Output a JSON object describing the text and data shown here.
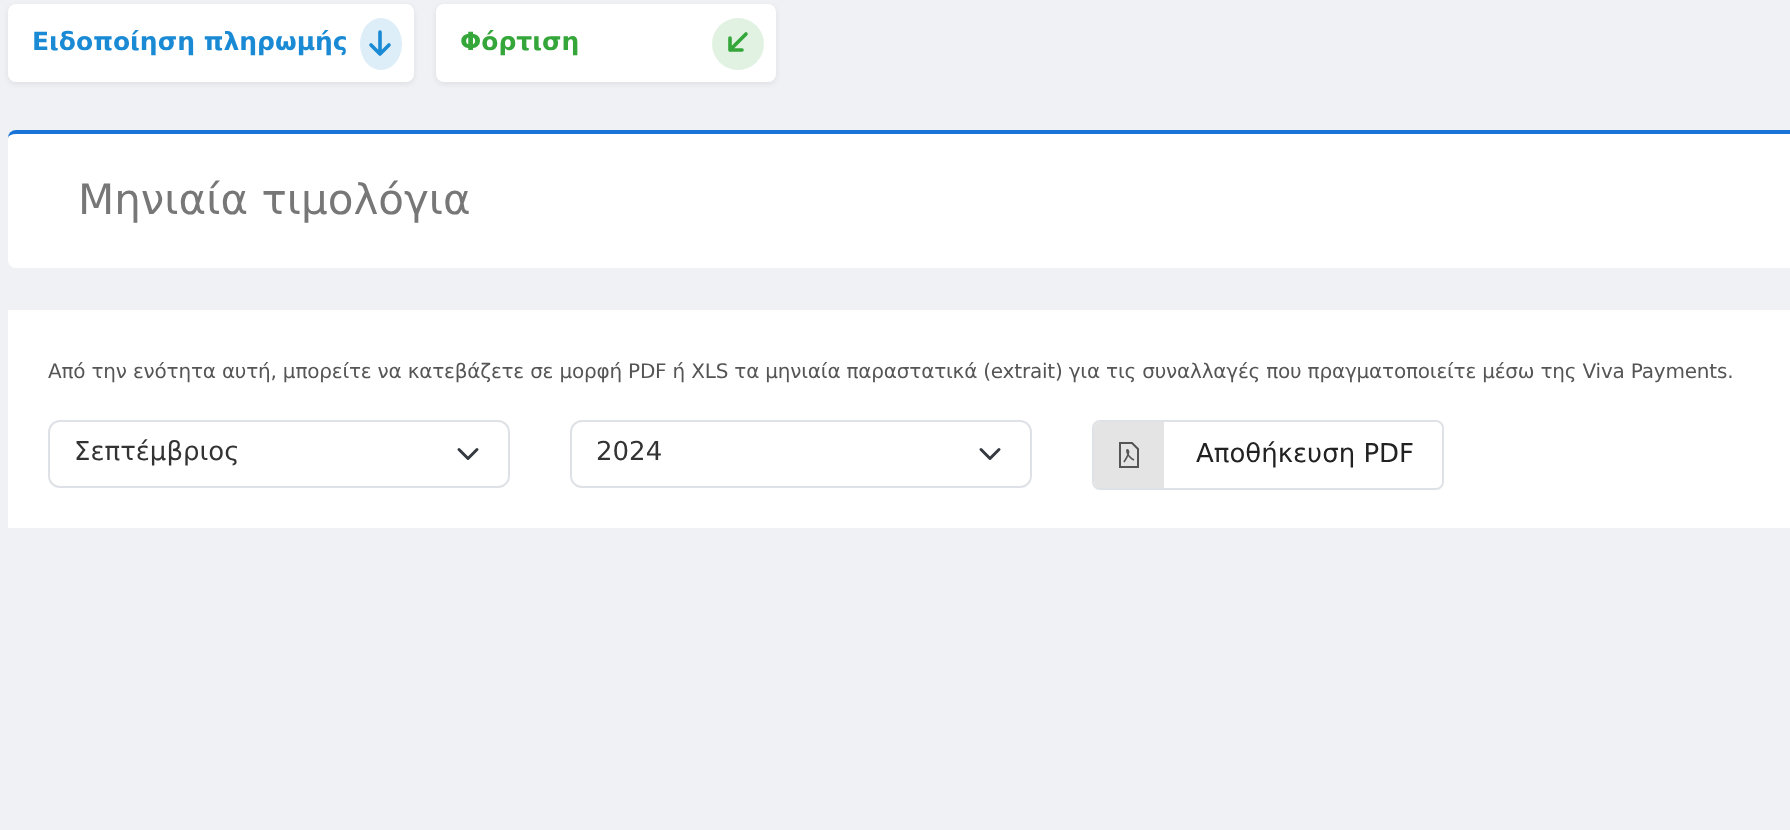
{
  "actions": [
    {
      "label": "Ειδοποίηση πληρωμής",
      "color": "#1a8ad4",
      "kind": "down"
    },
    {
      "label": "Φόρτιση",
      "color": "#34a63a",
      "kind": "down-left"
    }
  ],
  "title": "Μηνιαία τιμολόγια",
  "description": "Από την ενότητα αυτή, μπορείτε να κατεβάζετε σε μορφή PDF ή XLS τα μηνιαία παραστατικά (extrait) για τις συναλλαγές που πραγματοποιείτε μέσω της Viva Payments.",
  "month_select": {
    "value": "Σεπτέμβριος"
  },
  "year_select": {
    "value": "2024"
  },
  "save_button": {
    "label": "Αποθήκευση PDF"
  }
}
